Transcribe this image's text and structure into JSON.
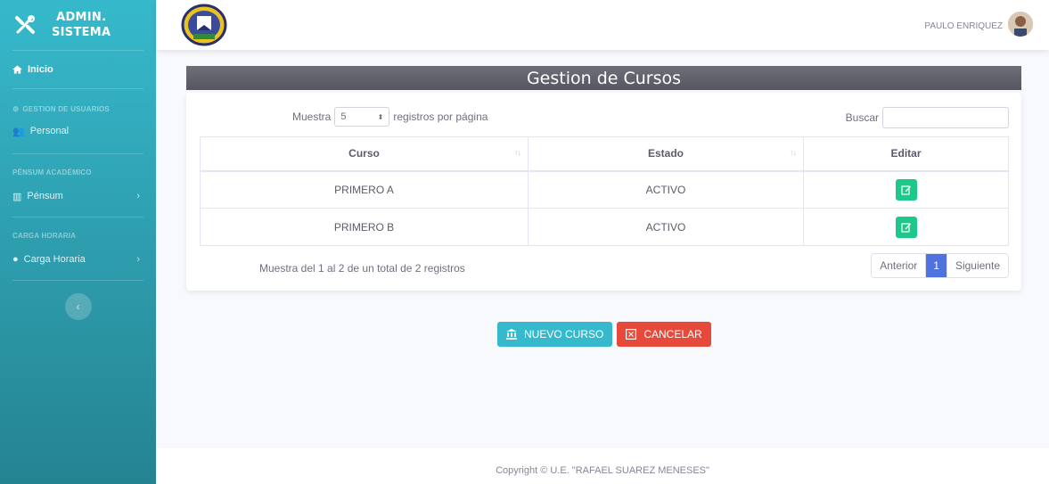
{
  "sidebar": {
    "brand": {
      "line1": "ADMIN.",
      "line2": "SISTEMA"
    },
    "home": "Inicio",
    "sections": [
      {
        "heading": "GESTION DE USUARIOS",
        "item": "Personal"
      },
      {
        "heading": "PÉNSUM ACADÉMICO",
        "item": "Pénsum"
      },
      {
        "heading": "CARGA HORARIA",
        "item": "Carga Horaria"
      }
    ]
  },
  "topbar": {
    "user_name": "PAULO ENRIQUEZ"
  },
  "page": {
    "title": "Gestion de Cursos"
  },
  "table_controls": {
    "show_label": "Muestra",
    "page_size": "5",
    "per_page_label": "registros por página",
    "search_label": "Buscar"
  },
  "table": {
    "headers": [
      "Curso",
      "Estado",
      "Editar"
    ],
    "rows": [
      {
        "curso": "PRIMERO A",
        "estado": "ACTIVO"
      },
      {
        "curso": "PRIMERO B",
        "estado": "ACTIVO"
      }
    ]
  },
  "pagination": {
    "info": "Muestra del 1 al 2 de un total de 2 registros",
    "previous": "Anterior",
    "current": "1",
    "next": "Siguiente"
  },
  "buttons": {
    "new": "NUEVO CURSO",
    "cancel": "CANCELAR"
  },
  "footer": {
    "text": "Copyright © U.E. \"RAFAEL SUAREZ MENESES\""
  },
  "colors": {
    "sidebar": "#36b9cc",
    "title_bar": "#5a5b64",
    "success": "#1cc88a",
    "danger": "#e74a3b",
    "primary": "#4e73df"
  }
}
